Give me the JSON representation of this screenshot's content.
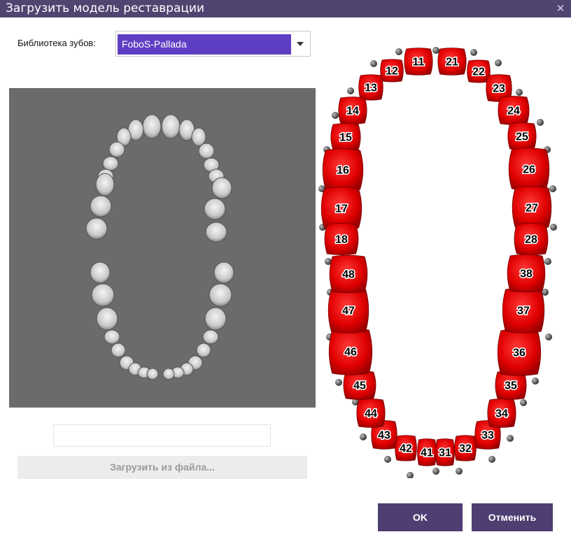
{
  "window": {
    "title": "Загрузить модель реставрации",
    "close_glyph": "✕"
  },
  "library": {
    "label": "Библиотека зубов:",
    "selected": "FoboS-Pallada"
  },
  "preview": {
    "filename": ""
  },
  "load_button": "Загрузить из файла...",
  "buttons": {
    "ok": "OK",
    "cancel": "Отменить"
  },
  "colors": {
    "title_bar": "#4f4570",
    "select_highlight": "#5e3fc4",
    "button": "#4e3e72",
    "tooth": "#e00000",
    "preview_bg": "#6b6b6b"
  },
  "teeth": [
    "11",
    "12",
    "13",
    "14",
    "15",
    "16",
    "17",
    "18",
    "21",
    "22",
    "23",
    "24",
    "25",
    "26",
    "27",
    "28",
    "31",
    "32",
    "33",
    "34",
    "35",
    "36",
    "37",
    "38",
    "41",
    "42",
    "43",
    "44",
    "45",
    "46",
    "47",
    "48"
  ]
}
